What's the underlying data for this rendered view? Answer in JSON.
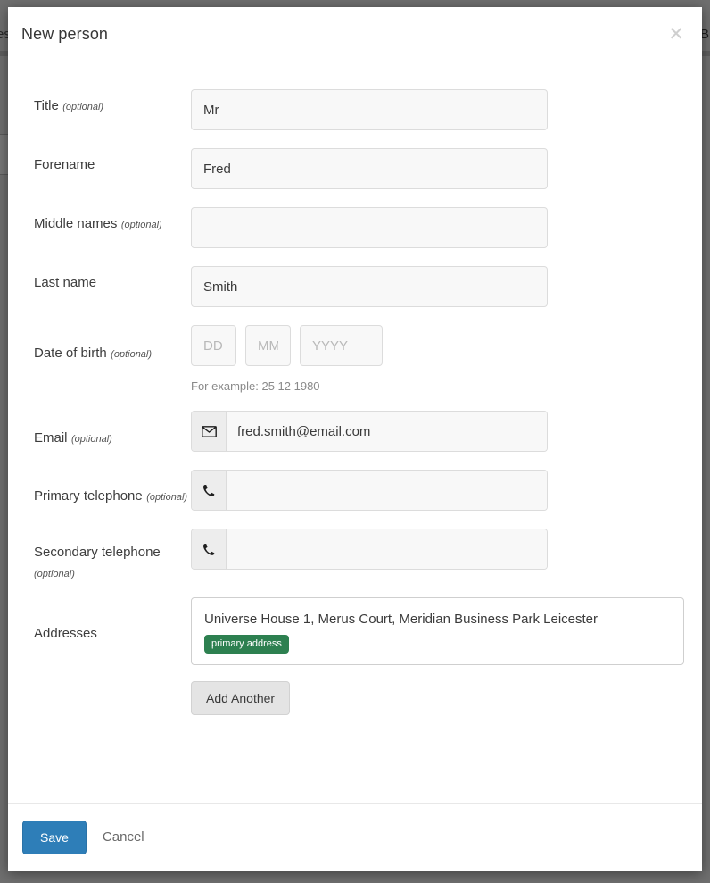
{
  "backdrop": {
    "left_fragment": "es",
    "right_fragment": "B"
  },
  "modal": {
    "title": "New person",
    "close_icon": "close-icon"
  },
  "form": {
    "optional_suffix": "(optional)",
    "fields": {
      "title": {
        "label": "Title",
        "optional": "(optional)",
        "value": "Mr",
        "placeholder": ""
      },
      "forename": {
        "label": "Forename",
        "optional": "",
        "value": "Fred",
        "placeholder": ""
      },
      "middle_names": {
        "label": "Middle names",
        "optional": "(optional)",
        "value": "",
        "placeholder": ""
      },
      "last_name": {
        "label": "Last name",
        "optional": "",
        "value": "Smith",
        "placeholder": ""
      },
      "date_of_birth": {
        "label": "Date of birth",
        "optional": "(optional)",
        "day_value": "",
        "day_placeholder": "DD",
        "month_value": "",
        "month_placeholder": "MM",
        "year_value": "",
        "year_placeholder": "YYYY",
        "hint": "For example: 25 12 1980"
      },
      "email": {
        "label": "Email",
        "optional": "(optional)",
        "icon": "envelope-icon",
        "value": "fred.smith@email.com",
        "placeholder": ""
      },
      "primary_telephone": {
        "label": "Primary telephone",
        "optional": "(optional)",
        "icon": "phone-icon",
        "value": "",
        "placeholder": ""
      },
      "secondary_telephone": {
        "label": "Secondary telephone",
        "optional": "(optional)",
        "icon": "phone-icon",
        "value": "",
        "placeholder": ""
      },
      "addresses": {
        "label": "Addresses",
        "optional": "",
        "entry_text": "Universe House 1, Merus Court, Meridian Business Park Leicester",
        "badge_label": "primary address",
        "badge_color": "#2d8050",
        "add_another_label": "Add Another"
      }
    }
  },
  "footer": {
    "save_label": "Save",
    "save_color": "#2e7eb8",
    "cancel_label": "Cancel"
  }
}
